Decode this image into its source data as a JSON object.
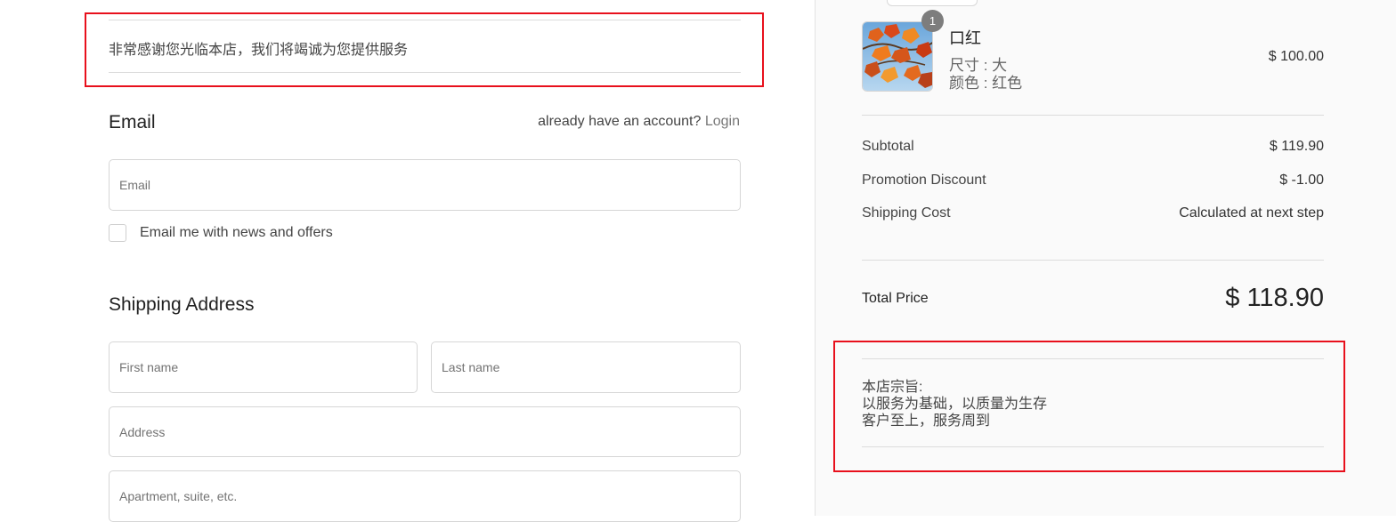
{
  "notice": {
    "text": "非常感谢您光临本店，我们将竭诚为您提供服务"
  },
  "contact": {
    "title": "Email",
    "account_prompt": "already have an account?",
    "login_link": "Login",
    "email_placeholder": "Email",
    "newsletter_label": "Email me with news and offers"
  },
  "shipping": {
    "title": "Shipping Address",
    "first_name_placeholder": "First name",
    "last_name_placeholder": "Last name",
    "address_placeholder": "Address",
    "apartment_placeholder": "Apartment, suite, etc."
  },
  "cart": {
    "item": {
      "quantity": "1",
      "name": "口红",
      "size": "尺寸 : 大",
      "color": "颜色 : 红色",
      "price": "$ 100.00",
      "image": "autumn-leaves-thumbnail"
    },
    "summary": {
      "subtotal_label": "Subtotal",
      "subtotal_value": "$ 119.90",
      "discount_label": "Promotion Discount",
      "discount_value": "$ -1.00",
      "shipping_label": "Shipping Cost",
      "shipping_value": "Calculated at next step"
    },
    "total_label": "Total Price",
    "total_value": "$ 118.90"
  },
  "motto": {
    "line1": "本店宗旨:",
    "line2": "以服务为基础，以质量为生存",
    "line3": "客户至上，服务周到"
  },
  "colors": {
    "highlight_border": "#e8101c",
    "sidebar_background": "#fafafa",
    "badge": "#7d7d7d"
  }
}
